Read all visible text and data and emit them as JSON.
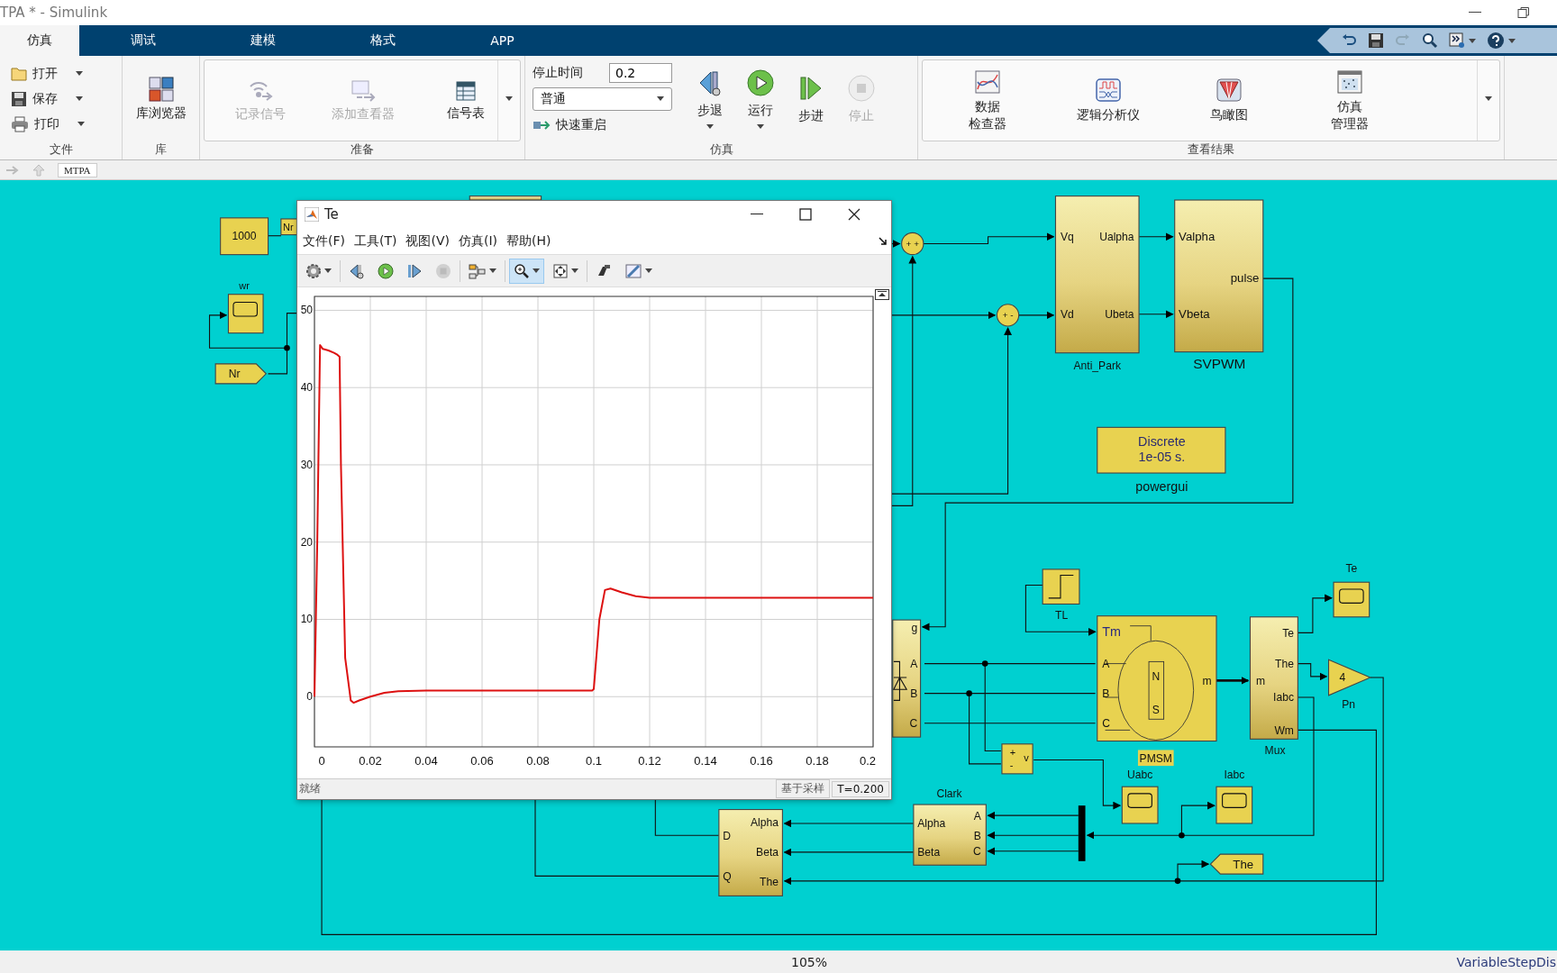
{
  "window": {
    "title": "TPA * - Simulink"
  },
  "tabs": [
    {
      "label": "仿真",
      "selected": true
    },
    {
      "label": "调试",
      "selected": false
    },
    {
      "label": "建模",
      "selected": false
    },
    {
      "label": "格式",
      "selected": false
    },
    {
      "label": "APP",
      "selected": false
    }
  ],
  "quick_access": [
    {
      "kind": "undo",
      "disabled": false
    },
    {
      "kind": "save",
      "disabled": false
    },
    {
      "kind": "redo",
      "disabled": true
    },
    {
      "kind": "search",
      "disabled": false
    },
    {
      "kind": "customize",
      "disabled": false
    },
    {
      "kind": "help",
      "disabled": false
    }
  ],
  "ribbon": {
    "file_section": {
      "label": "文件",
      "items": [
        "打开",
        "保存",
        "打印"
      ]
    },
    "library_section": {
      "label": "库",
      "button": "库浏览器"
    },
    "prepare_section": {
      "label": "准备",
      "items": [
        {
          "label": "记录信号",
          "disabled": true
        },
        {
          "label": "添加查看器",
          "disabled": true
        },
        {
          "label": "信号表",
          "disabled": false
        }
      ]
    },
    "simulate_section": {
      "label": "仿真",
      "stop_time_label": "停止时间",
      "stop_time": "0.2",
      "mode": "普通",
      "fast_restart": "快速重启",
      "buttons": [
        {
          "kind": "step-back",
          "label": "步退",
          "disabled": false,
          "dropdown": true
        },
        {
          "kind": "run",
          "label": "运行",
          "disabled": false,
          "dropdown": true
        },
        {
          "kind": "step-forward",
          "label": "步进",
          "disabled": false,
          "dropdown": false
        },
        {
          "kind": "stop",
          "label": "停止",
          "disabled": true,
          "dropdown": false
        }
      ]
    },
    "results_section": {
      "label": "查看结果",
      "items": [
        {
          "kind": "inspector",
          "lines": [
            "数据",
            "检查器"
          ]
        },
        {
          "kind": "logic",
          "lines": [
            "逻辑分析仪"
          ]
        },
        {
          "kind": "birdseye",
          "lines": [
            "鸟瞰图"
          ]
        },
        {
          "kind": "manager",
          "lines": [
            "仿真",
            "管理器"
          ]
        }
      ]
    }
  },
  "breadcrumb": "MTPA",
  "model": {
    "constant": "1000",
    "goto_tag": "Nr",
    "wr_scope": "wr",
    "from_tag": "Nr",
    "anti_park": {
      "name": "Anti_Park",
      "ports": [
        "Vq",
        "Vd",
        "Ualpha",
        "Ubeta"
      ]
    },
    "svpwm": {
      "name": "SVPWM",
      "ports": [
        "Valpha",
        "Vbeta",
        "pulse"
      ]
    },
    "powergui": {
      "name": "powergui",
      "lines": [
        "Discrete",
        "1e-05 s."
      ]
    },
    "inverter": {
      "ports": [
        "g",
        "A",
        "B",
        "C"
      ]
    },
    "step": "TL",
    "pmsm": {
      "name": "PMSM",
      "ports": [
        "Tm",
        "A",
        "B",
        "C",
        "m"
      ],
      "rotor": [
        "N",
        "S"
      ]
    },
    "voltage": {
      "ports": [
        "+",
        "-",
        "v"
      ]
    },
    "mux": {
      "name": "Mux",
      "ports": [
        "m",
        "Te",
        "The",
        "Iabc",
        "Wm"
      ]
    },
    "te_scope": "Te",
    "gain": {
      "name": "Pn",
      "value": "4"
    },
    "uabc_scope": "Uabc",
    "iabc_scope": "Iabc",
    "clark": {
      "name": "Clark",
      "ports": [
        "Alpha",
        "Beta",
        "A",
        "B",
        "C"
      ]
    },
    "park": {
      "ports": [
        "D",
        "Q",
        "Alpha",
        "Beta",
        "The"
      ]
    },
    "the_tag": "The",
    "sum_signs": [
      "+ +",
      "+ -"
    ]
  },
  "scope": {
    "title": "Te",
    "menu": [
      "文件(F)",
      "工具(T)",
      "视图(V)",
      "仿真(I)",
      "帮助(H)"
    ],
    "toolbar": [
      {
        "kind": "settings",
        "selected": false,
        "dropdown": true,
        "disabled": false
      },
      {
        "kind": "step-back",
        "selected": false,
        "dropdown": false,
        "disabled": false
      },
      {
        "kind": "run",
        "selected": false,
        "dropdown": false,
        "disabled": false
      },
      {
        "kind": "step-forward",
        "selected": false,
        "dropdown": false,
        "disabled": false
      },
      {
        "kind": "stop",
        "selected": false,
        "dropdown": false,
        "disabled": true
      },
      {
        "kind": "layout",
        "selected": false,
        "dropdown": true,
        "disabled": false
      },
      {
        "kind": "zoom",
        "selected": true,
        "dropdown": true,
        "disabled": false
      },
      {
        "kind": "fit",
        "selected": false,
        "dropdown": true,
        "disabled": false
      },
      {
        "kind": "style",
        "selected": false,
        "dropdown": false,
        "disabled": false
      },
      {
        "kind": "measure",
        "selected": false,
        "dropdown": true,
        "disabled": false
      }
    ],
    "chart_data": {
      "type": "line",
      "x": [
        0,
        0.001,
        0.002,
        0.003,
        0.005,
        0.007,
        0.008,
        0.009,
        0.0095,
        0.011,
        0.013,
        0.014,
        0.016,
        0.02,
        0.025,
        0.03,
        0.04,
        0.06,
        0.08,
        0.0995,
        0.1,
        0.102,
        0.104,
        0.106,
        0.11,
        0.115,
        0.12,
        0.14,
        0.16,
        0.18,
        0.2
      ],
      "grid": true,
      "series": [
        {
          "color": "#dd1111",
          "values": [
            0,
            20,
            45.5,
            45,
            44.8,
            44.5,
            44.3,
            44,
            30,
            5,
            -0.5,
            -0.8,
            -0.5,
            0,
            0.5,
            0.7,
            0.8,
            0.8,
            0.8,
            0.8,
            1,
            10,
            13.8,
            14,
            13.5,
            13,
            12.8,
            12.8,
            12.8,
            12.8,
            12.8
          ]
        }
      ],
      "xlim": [
        0,
        0.2
      ],
      "ylim": [
        -6.5,
        51.8
      ],
      "xticks": [
        0,
        0.02,
        0.04,
        0.06,
        0.08,
        0.1,
        0.12,
        0.14,
        0.16,
        0.18,
        0.2
      ],
      "yticks": [
        0,
        10,
        20,
        30,
        40,
        50
      ]
    },
    "status": "就绪",
    "status_mode": "基于采样",
    "status_time": "T=0.200"
  },
  "status_bar": {
    "zoom": "105%",
    "solver": "VariableStepDis"
  }
}
